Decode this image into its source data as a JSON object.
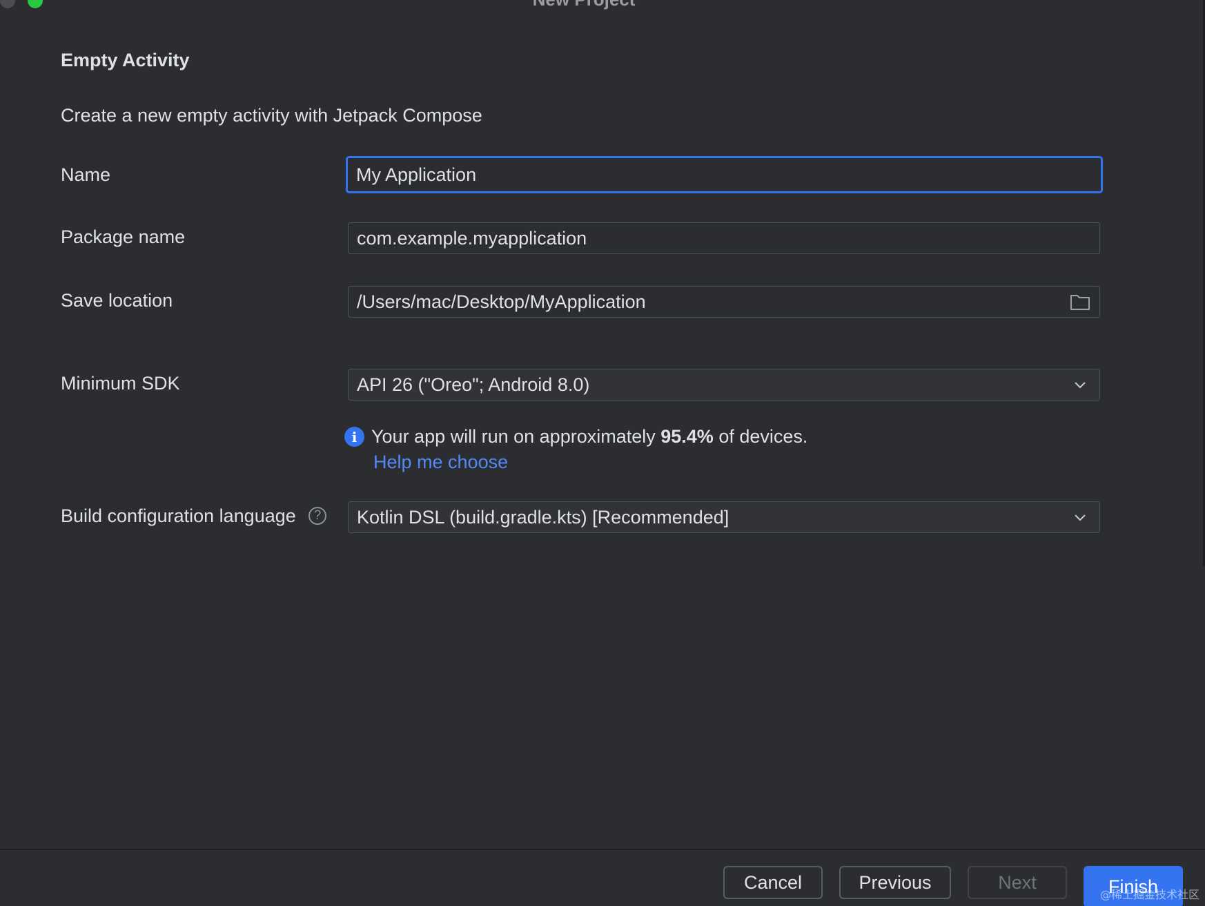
{
  "window": {
    "title": "New Project"
  },
  "page": {
    "heading": "Empty Activity",
    "description": "Create a new empty activity with Jetpack Compose"
  },
  "form": {
    "name": {
      "label": "Name",
      "value": "My Application"
    },
    "package_name": {
      "label": "Package name",
      "value": "com.example.myapplication"
    },
    "save_location": {
      "label": "Save location",
      "value": "/Users/mac/Desktop/MyApplication",
      "icon": "folder-icon"
    },
    "minimum_sdk": {
      "label": "Minimum SDK",
      "value": "API 26 (\"Oreo\"; Android 8.0)",
      "icon": "chevron-down-icon"
    },
    "sdk_info": {
      "icon": "info-icon",
      "prefix": "Your app will run on approximately ",
      "percentage": "95.4%",
      "suffix": " of devices.",
      "help_link": "Help me choose"
    },
    "build_language": {
      "label": "Build configuration language",
      "help_icon": "question-icon",
      "value": "Kotlin DSL (build.gradle.kts) [Recommended]",
      "icon": "chevron-down-icon"
    }
  },
  "footer": {
    "cancel_label": "Cancel",
    "previous_label": "Previous",
    "next_label": "Next",
    "finish_label": "Finish"
  },
  "watermark": "@稀土掘金技术社区",
  "colors": {
    "background": "#2b2d30",
    "accent": "#3574f0",
    "link": "#548af7",
    "text": "#dfe1e5"
  }
}
